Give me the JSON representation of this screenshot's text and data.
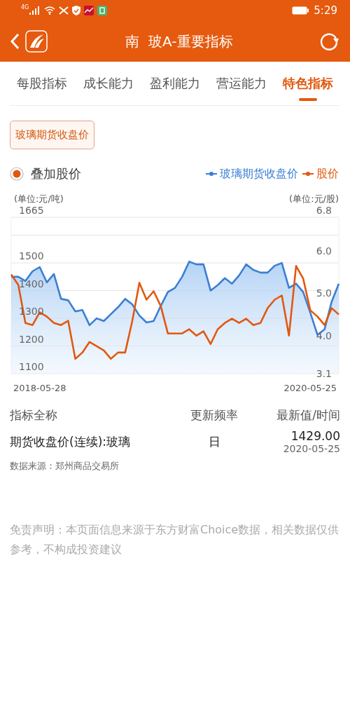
{
  "status_bar": {
    "time": "5:29",
    "signal_label": "4G"
  },
  "header": {
    "title": "南  玻A-重要指标"
  },
  "tabs": [
    {
      "label": "每股指标",
      "selected": false
    },
    {
      "label": "成长能力",
      "selected": false
    },
    {
      "label": "盈利能力",
      "selected": false
    },
    {
      "label": "营运能力",
      "selected": false
    },
    {
      "label": "特色指标",
      "selected": true
    }
  ],
  "indicator_chips": [
    {
      "label": "玻璃期货收盘价",
      "selected": true
    }
  ],
  "overlay": {
    "label": "叠加股价",
    "checked": true
  },
  "chart": {
    "left_unit": "(单位:元/吨)",
    "right_unit": "(单位:元/股)",
    "chart_data": {
      "type": "line",
      "grid": true,
      "categories": [
        null,
        null,
        null,
        null,
        "2018-05-28",
        null,
        null,
        null,
        null,
        null,
        null,
        null,
        null,
        null,
        null,
        null,
        null,
        null,
        null,
        null,
        null,
        null,
        null,
        null,
        null,
        null,
        null,
        null,
        null,
        null,
        null,
        null,
        null,
        null,
        null,
        null,
        null,
        null,
        null,
        null,
        null,
        null,
        "2020-05-25",
        null,
        null,
        null,
        null
      ],
      "ylim": [
        1100,
        1665
      ],
      "yticks": [
        1100,
        1200,
        1300,
        1400,
        1500,
        1665
      ],
      "y2lim": [
        3.1,
        6.8
      ],
      "y2ticks": [
        3.1,
        {
          "value": 4,
          "label": "4.0"
        },
        {
          "value": 5,
          "label": "5.0"
        },
        {
          "value": 6,
          "label": "6.0"
        },
        6.8
      ],
      "series": [
        {
          "name": "玻璃期货收盘价",
          "color": "#3a7fd5",
          "axis": "y",
          "values": [
            1450,
            1450,
            1435,
            1470,
            1485,
            1430,
            1460,
            1370,
            1365,
            1325,
            1330,
            1275,
            1300,
            1290,
            1315,
            1340,
            1370,
            1350,
            1310,
            1285,
            1290,
            1345,
            1395,
            1410,
            1450,
            1505,
            1495,
            1495,
            1400,
            1420,
            1445,
            1425,
            1455,
            1495,
            1475,
            1465,
            1465,
            1490,
            1500,
            1410,
            1425,
            1395,
            1320,
            1240,
            1260,
            1360,
            1425
          ]
        },
        {
          "name": "股价",
          "color": "#e2580f",
          "axis": "y2",
          "values": [
            5.45,
            5.2,
            4.3,
            4.25,
            4.55,
            4.45,
            4.3,
            4.25,
            4.35,
            3.45,
            3.6,
            3.85,
            3.75,
            3.65,
            3.45,
            3.6,
            3.6,
            4.35,
            5.25,
            4.85,
            5.05,
            4.7,
            4.05,
            4.05,
            4.05,
            4.15,
            4.0,
            4.1,
            3.8,
            4.15,
            4.3,
            4.4,
            4.3,
            4.4,
            4.25,
            4.3,
            4.65,
            4.85,
            4.95,
            4.0,
            5.65,
            5.35,
            4.6,
            4.45,
            4.25,
            4.65,
            4.5
          ]
        }
      ]
    }
  },
  "table": {
    "columns": [
      "指标全称",
      "更新频率",
      "最新值/时间"
    ],
    "rows": [
      {
        "name": "期货收盘价(连续):玻璃",
        "frequency": "日",
        "value": "1429.00",
        "date": "2020-05-25"
      }
    ]
  },
  "source": "数据来源：郑州商品交易所",
  "disclaimer": "免责声明：本页面信息来源于东方财富Choice数据，相关数据仅供参考，不构成投资建议"
}
